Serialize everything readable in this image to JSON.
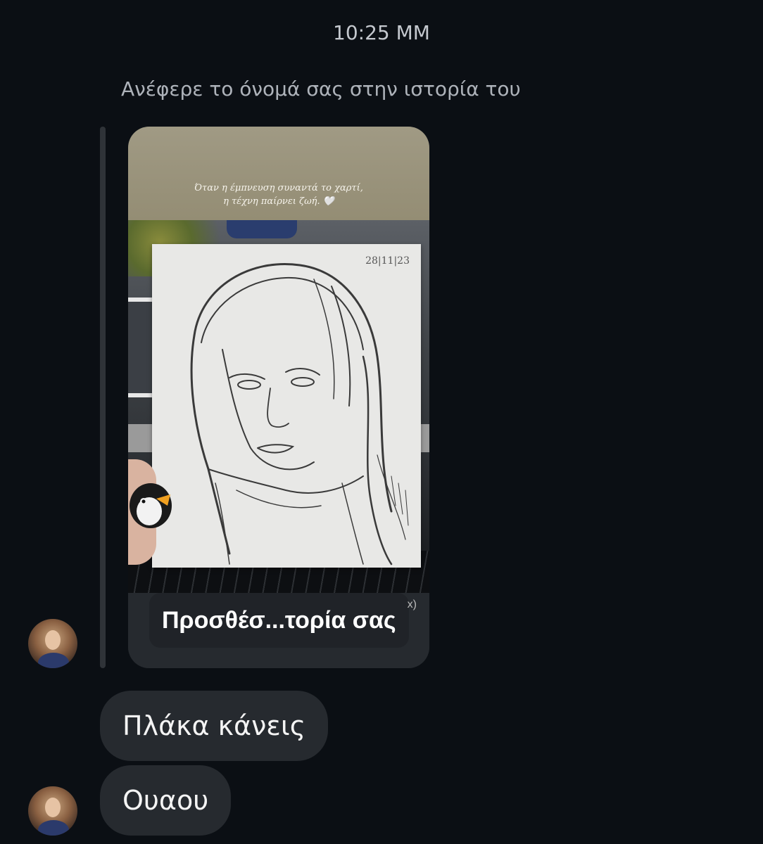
{
  "thread": {
    "timestamp": "10:25 ΜΜ",
    "mention_note": "Ανέφερε το όνομά σας στην ιστορία του"
  },
  "story": {
    "caption_line1": "Όταν η έμπνευση συναντά το χαρτί,",
    "caption_line2": "η τέχνη παίρνει ζωή. 🤍",
    "sketch_date": "28|11|23",
    "add_to_story_label": "Προσθέσ...τορία σας",
    "footer_glyph": "x)"
  },
  "messages": [
    {
      "text": "Πλάκα κάνεις"
    },
    {
      "text": "Ουαου"
    }
  ],
  "colors": {
    "background": "#0b0f14",
    "bubble": "#262a2f",
    "text_primary": "#f4f4f4",
    "text_secondary": "#aeb3ba"
  }
}
